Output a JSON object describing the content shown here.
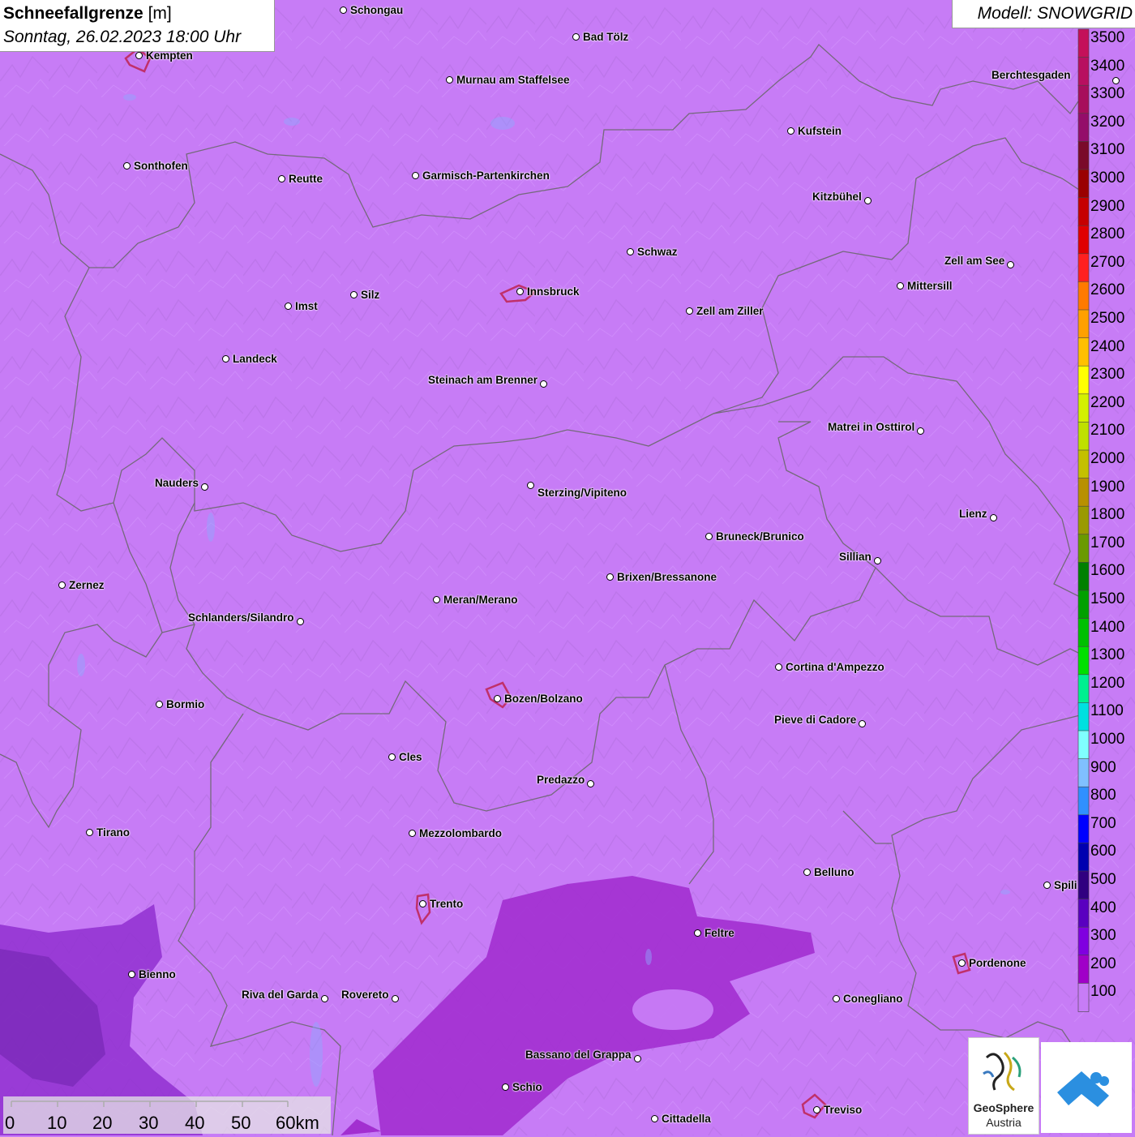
{
  "header": {
    "title": "Schneefallgrenze",
    "unit": "[m]",
    "datetime": "Sonntag, 26.02.2023 18:00 Uhr"
  },
  "model": {
    "label": "Modell: SNOWGRID"
  },
  "legend": {
    "levels": [
      "3500",
      "3400",
      "3300",
      "3200",
      "3100",
      "3000",
      "2900",
      "2800",
      "2700",
      "2600",
      "2500",
      "2400",
      "2300",
      "2200",
      "2100",
      "2000",
      "1900",
      "1800",
      "1700",
      "1600",
      "1500",
      "1400",
      "1300",
      "1200",
      "1100",
      "1000",
      "900",
      "800",
      "700",
      "600",
      "500",
      "400",
      "300",
      "200",
      "100"
    ],
    "colors": [
      "#c4105a",
      "#b80f60",
      "#a70e5c",
      "#940d6a",
      "#7a0a2a",
      "#9a0000",
      "#c60000",
      "#e00000",
      "#ff2020",
      "#ff7a00",
      "#ffa000",
      "#ffc000",
      "#ffff00",
      "#d4f000",
      "#bfe000",
      "#c4c000",
      "#b89000",
      "#9a9a00",
      "#6a9a00",
      "#008000",
      "#00a000",
      "#00c000",
      "#00e000",
      "#00f090",
      "#00e0e0",
      "#80ffff",
      "#80c0ff",
      "#3090ff",
      "#0000ff",
      "#0000b0",
      "#300080",
      "#5a00c0",
      "#8000e0",
      "#a000c8",
      "#c77cf6"
    ]
  },
  "cities": [
    {
      "name": "Schongau"
    },
    {
      "name": "Kempten"
    },
    {
      "name": "Bad Tölz"
    },
    {
      "name": "Murnau am Staffelsee"
    },
    {
      "name": "Berchtesgaden"
    },
    {
      "name": "Kufstein"
    },
    {
      "name": "Sonthofen"
    },
    {
      "name": "Reutte"
    },
    {
      "name": "Garmisch-Partenkirchen"
    },
    {
      "name": "Kitzbühel"
    },
    {
      "name": "Schwaz"
    },
    {
      "name": "Zell am See"
    },
    {
      "name": "Innsbruck"
    },
    {
      "name": "Mittersill"
    },
    {
      "name": "Imst"
    },
    {
      "name": "Silz"
    },
    {
      "name": "Zell am Ziller"
    },
    {
      "name": "Landeck"
    },
    {
      "name": "Steinach am Brenner"
    },
    {
      "name": "Matrei in Osttirol"
    },
    {
      "name": "Nauders"
    },
    {
      "name": "Sterzing/Vipiteno"
    },
    {
      "name": "Lienz"
    },
    {
      "name": "Bruneck/Brunico"
    },
    {
      "name": "Sillian"
    },
    {
      "name": "Zernez"
    },
    {
      "name": "Brixen/Bressanone"
    },
    {
      "name": "Meran/Merano"
    },
    {
      "name": "Schlanders/Silandro"
    },
    {
      "name": "Cortina d'Ampezzo"
    },
    {
      "name": "Bormio"
    },
    {
      "name": "Bozen/Bolzano"
    },
    {
      "name": "Pieve di Cadore"
    },
    {
      "name": "Cles"
    },
    {
      "name": "Predazzo"
    },
    {
      "name": "Tirano"
    },
    {
      "name": "Mezzolombardo"
    },
    {
      "name": "Belluno"
    },
    {
      "name": "Trento"
    },
    {
      "name": "Feltre"
    },
    {
      "name": "Pordenone"
    },
    {
      "name": "Bienno"
    },
    {
      "name": "Riva del Garda"
    },
    {
      "name": "Rovereto"
    },
    {
      "name": "Conegliano"
    },
    {
      "name": "Bassano del Grappa"
    },
    {
      "name": "Schio"
    },
    {
      "name": "Treviso"
    },
    {
      "name": "Cittadella"
    },
    {
      "name": "Spili"
    }
  ],
  "scale": {
    "ticks": [
      "0",
      "10",
      "20",
      "30",
      "40",
      "50",
      "60km"
    ]
  },
  "logos": {
    "geosphere_line1": "GeoSphere",
    "geosphere_line2": "Austria"
  }
}
